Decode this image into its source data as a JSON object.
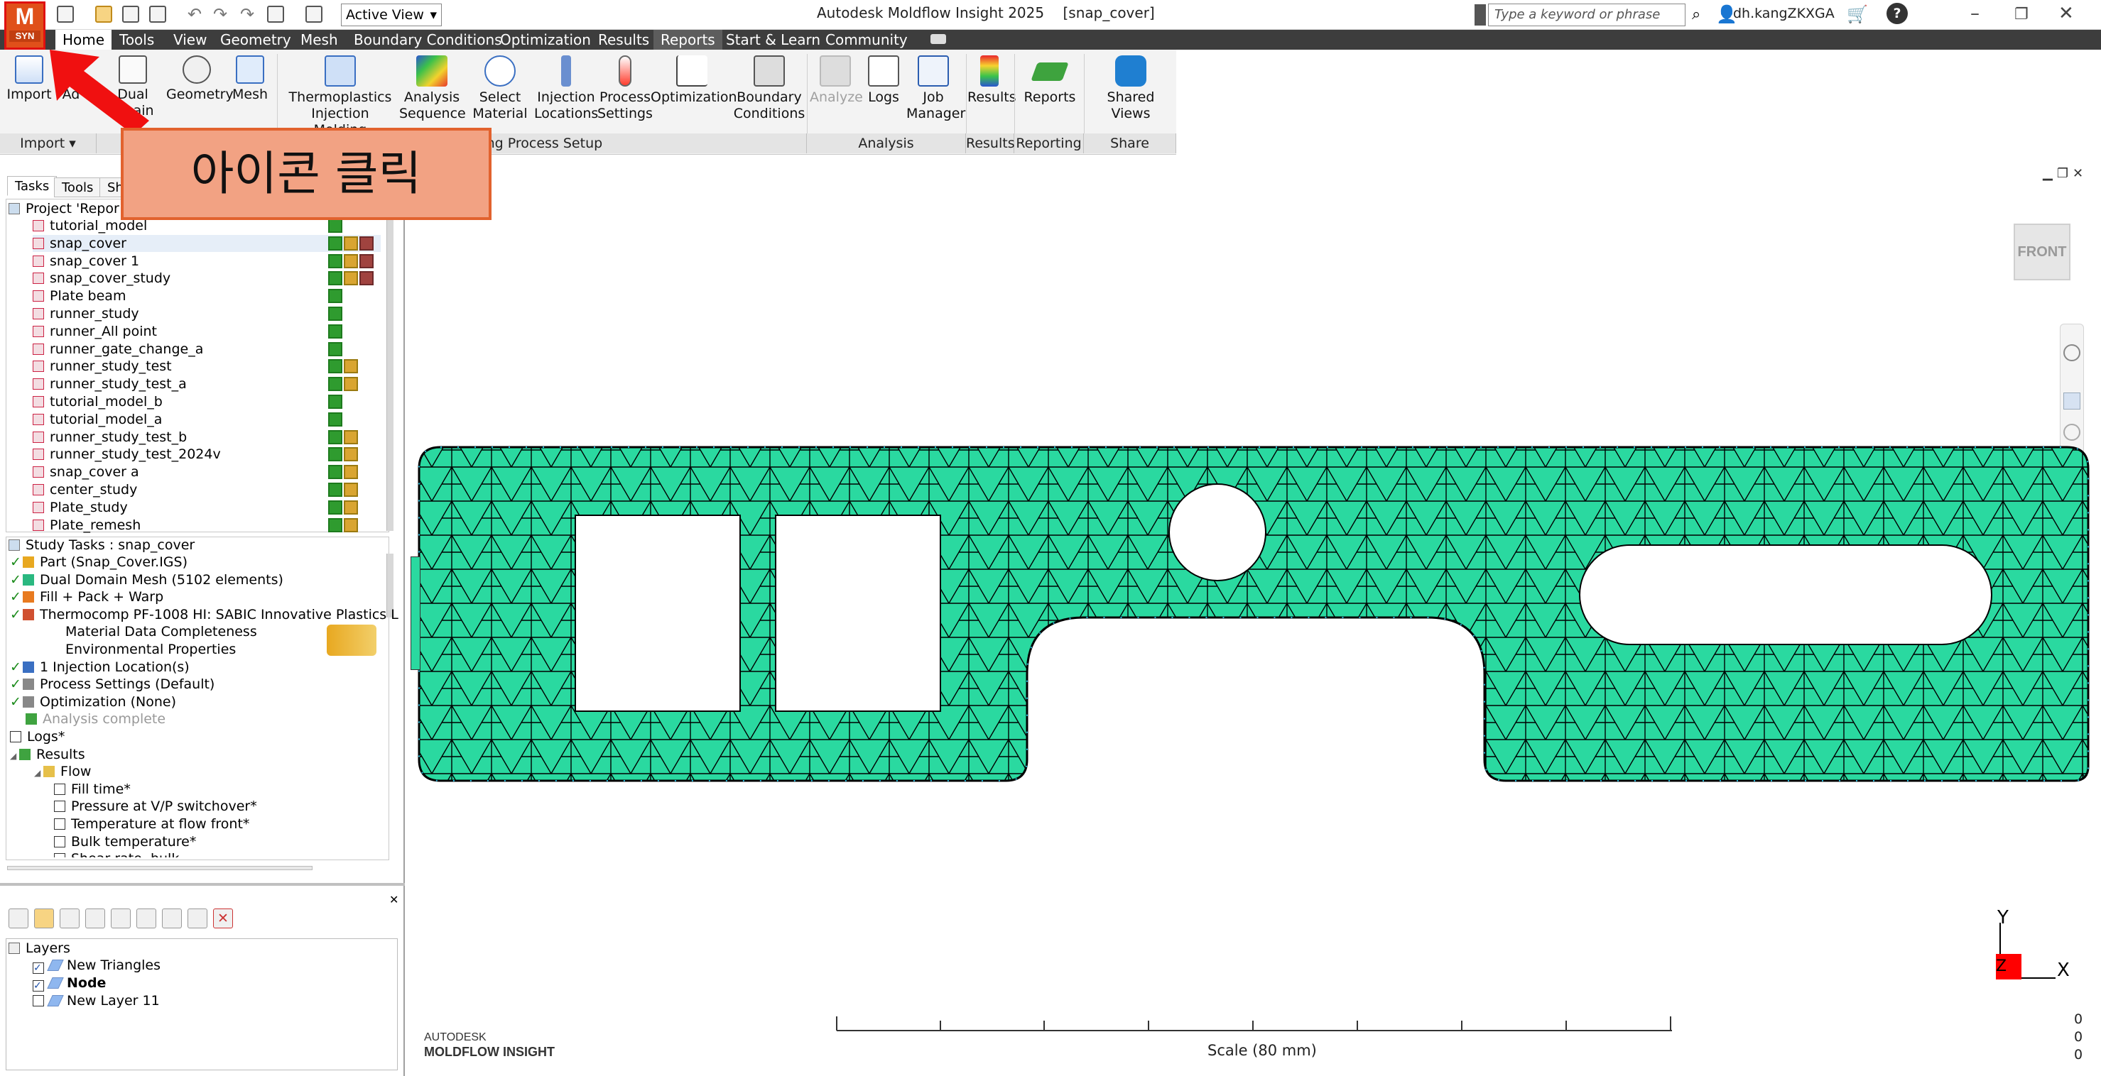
{
  "app": {
    "logo_letter": "M",
    "logo_sub": "SYN",
    "title": "Autodesk Moldflow Insight 2025",
    "doc": "[snap_cover]",
    "view_select": "Active View",
    "search_placeholder": "Type a keyword or phrase",
    "user": "dh.kangZKXGA"
  },
  "menu": [
    "Home",
    "Tools",
    "View",
    "Geometry",
    "Mesh",
    "Boundary Conditions",
    "Optimization",
    "Results",
    "Reports",
    "Start & Learn",
    "Community"
  ],
  "ribbon": {
    "import": "Import",
    "add": "Ad",
    "dual_domain": [
      "Dual",
      "omain"
    ],
    "geometry": "Geometry",
    "mesh": "Mesh",
    "thermoplastics": [
      "Thermoplastics",
      "Injection Molding"
    ],
    "analysis_seq": [
      "Analysis",
      "Sequence"
    ],
    "select_material": [
      "Select",
      "Material"
    ],
    "injection_locations": [
      "Injection",
      "Locations"
    ],
    "process_settings": [
      "Process",
      "Settings"
    ],
    "optimization": "Optimization",
    "boundary_conditions": [
      "Boundary",
      "Conditions"
    ],
    "analyze": "Analyze",
    "logs": "Logs",
    "job_manager": [
      "Job",
      "Manager"
    ],
    "results": "Results",
    "reports": "Reports",
    "shared_views": "Shared Views",
    "groups": {
      "import": "Import",
      "molding": "lding Process Setup",
      "analysis": "Analysis",
      "results": "Results",
      "reporting": "Reporting",
      "share": "Share"
    }
  },
  "callout": "아이콘 클릭",
  "panel_tabs": [
    "Tasks",
    "Tools",
    "Sh"
  ],
  "project": {
    "header": "Project 'Repor",
    "studies": [
      "tutorial_model",
      "snap_cover",
      "snap_cover 1",
      "snap_cover_study",
      "Plate beam",
      "runner_study",
      "runner_All point",
      "runner_gate_change_a",
      "runner_study_test",
      "runner_study_test_a",
      "tutorial_model_b",
      "tutorial_model_a",
      "runner_study_test_b",
      "runner_study_test_2024v",
      "snap_cover a",
      "center_study",
      "Plate_study",
      "Plate_remesh"
    ]
  },
  "study_tasks": {
    "header": "Study Tasks : snap_cover",
    "items": [
      "Part (Snap_Cover.IGS)",
      "Dual Domain Mesh (5102 elements)",
      "Fill + Pack + Warp",
      "Thermocomp PF-1008 HI: SABIC Innovative Plastics L",
      "Material Data Completeness",
      "Environmental Properties",
      "1 Injection Location(s)",
      "Process Settings (Default)",
      "Optimization (None)",
      "Analysis complete",
      "Logs*",
      "Results",
      "Flow",
      "Fill time*",
      "Pressure at V/P switchover*",
      "Temperature at flow front*",
      "Bulk temperature*",
      "Shear rate, bulk"
    ]
  },
  "layers": {
    "header": "Layers",
    "items": [
      {
        "name": "New Triangles",
        "checked": true
      },
      {
        "name": "Node",
        "checked": true
      },
      {
        "name": "New Layer 11",
        "checked": false
      }
    ]
  },
  "viewport": {
    "view_cube": "FRONT",
    "brand_top": "AUTODESK",
    "brand_bottom": "MOLDFLOW INSIGHT",
    "scale": "Scale (80 mm)",
    "coords": [
      "0",
      "0",
      "0"
    ],
    "axis_y": "Y",
    "axis_x": "X",
    "axis_z": "Z"
  },
  "colors": {
    "mesh_fill": "#2ad9a0",
    "menubar": "#3d3d3d",
    "callout_fill": "#f2a283",
    "callout_border": "#e2622e",
    "arrow": "#f01010"
  }
}
